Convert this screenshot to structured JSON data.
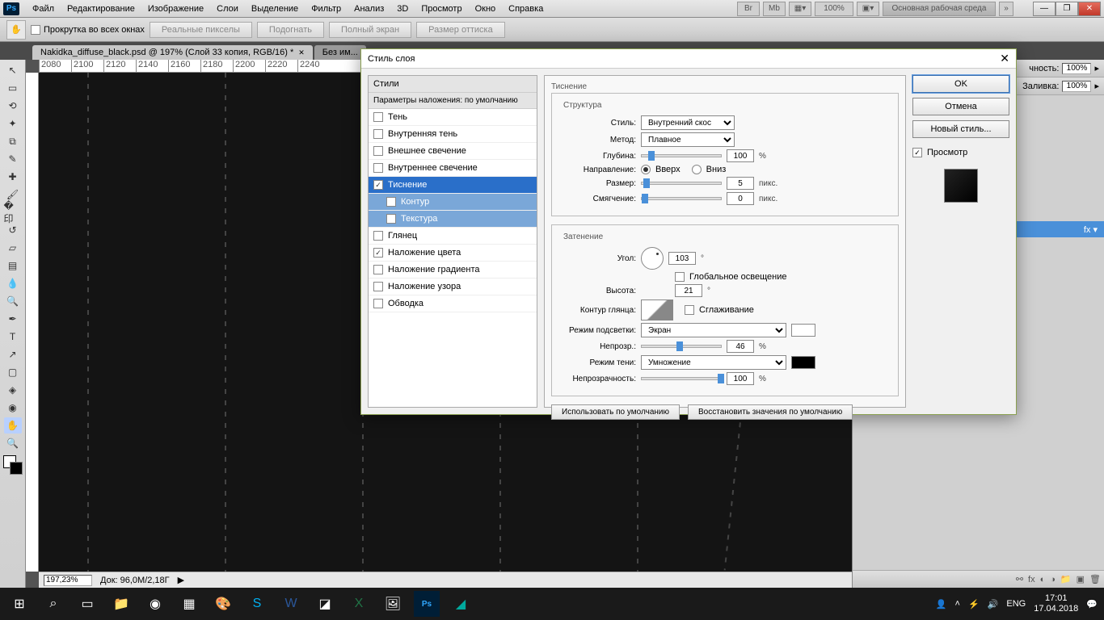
{
  "app": {
    "logo": "Ps"
  },
  "menu": [
    "Файл",
    "Редактирование",
    "Изображение",
    "Слои",
    "Выделение",
    "Фильтр",
    "Анализ",
    "3D",
    "Просмотр",
    "Окно",
    "Справка"
  ],
  "menubar_right": {
    "zoom": "100%",
    "workspace": "Основная рабочая среда"
  },
  "options": {
    "scroll_all": "Прокрутка во всех окнах",
    "btns": [
      "Реальные пикселы",
      "Подогнать",
      "Полный экран",
      "Размер оттиска"
    ]
  },
  "doctabs": [
    "Nakidka_diffuse_black.psd @ 197% (Слой 33 копия, RGB/16) *",
    "Без им..."
  ],
  "ruler_h": [
    "2080",
    "2100",
    "2120",
    "2140",
    "2160",
    "2180",
    "2200",
    "2220",
    "2240"
  ],
  "status": {
    "zoom": "197,23%",
    "doc": "Док: 96,0M/2,18Г"
  },
  "rightpanel": {
    "opacity_label": "чность:",
    "opacity": "100%",
    "fill_label": "Заливка:",
    "fill": "100%",
    "fx": "fx ▾"
  },
  "dialog": {
    "title": "Стиль слоя",
    "styles_head": "Стили",
    "blend_defaults": "Параметры наложения: по умолчанию",
    "items": {
      "drop_shadow": "Тень",
      "inner_shadow": "Внутренняя тень",
      "outer_glow": "Внешнее свечение",
      "inner_glow": "Внутреннее свечение",
      "bevel": "Тиснение",
      "contour": "Контур",
      "texture": "Текстура",
      "satin": "Глянец",
      "color_overlay": "Наложение цвета",
      "grad_overlay": "Наложение градиента",
      "pat_overlay": "Наложение узора",
      "stroke": "Обводка"
    },
    "section_bevel": "Тиснение",
    "group_structure": "Структура",
    "lbl_style": "Стиль:",
    "val_style": "Внутренний скос",
    "lbl_technique": "Метод:",
    "val_technique": "Плавное",
    "lbl_depth": "Глубина:",
    "val_depth": "100",
    "unit_pct": "%",
    "lbl_direction": "Направление:",
    "dir_up": "Вверх",
    "dir_down": "Вниз",
    "lbl_size": "Размер:",
    "val_size": "5",
    "unit_px": "пикс.",
    "lbl_soften": "Смягчение:",
    "val_soften": "0",
    "group_shading": "Затенение",
    "lbl_angle": "Угол:",
    "val_angle": "103",
    "unit_deg": "°",
    "lbl_global": "Глобальное освещение",
    "lbl_altitude": "Высота:",
    "val_altitude": "21",
    "lbl_gloss": "Контур глянца:",
    "lbl_anti": "Сглаживание",
    "lbl_highlight_mode": "Режим подсветки:",
    "val_highlight_mode": "Экран",
    "lbl_opacity_h": "Непрозр.:",
    "val_opacity_h": "46",
    "lbl_shadow_mode": "Режим тени:",
    "val_shadow_mode": "Умножение",
    "lbl_opacity_s": "Непрозрачность:",
    "val_opacity_s": "100",
    "btn_make_default": "Использовать по умолчанию",
    "btn_reset_default": "Восстановить значения по умолчанию",
    "btn_ok": "OK",
    "btn_cancel": "Отмена",
    "btn_new_style": "Новый стиль...",
    "lbl_preview": "Просмотр"
  },
  "taskbar": {
    "lang": "ENG",
    "time": "17:01",
    "date": "17.04.2018"
  }
}
